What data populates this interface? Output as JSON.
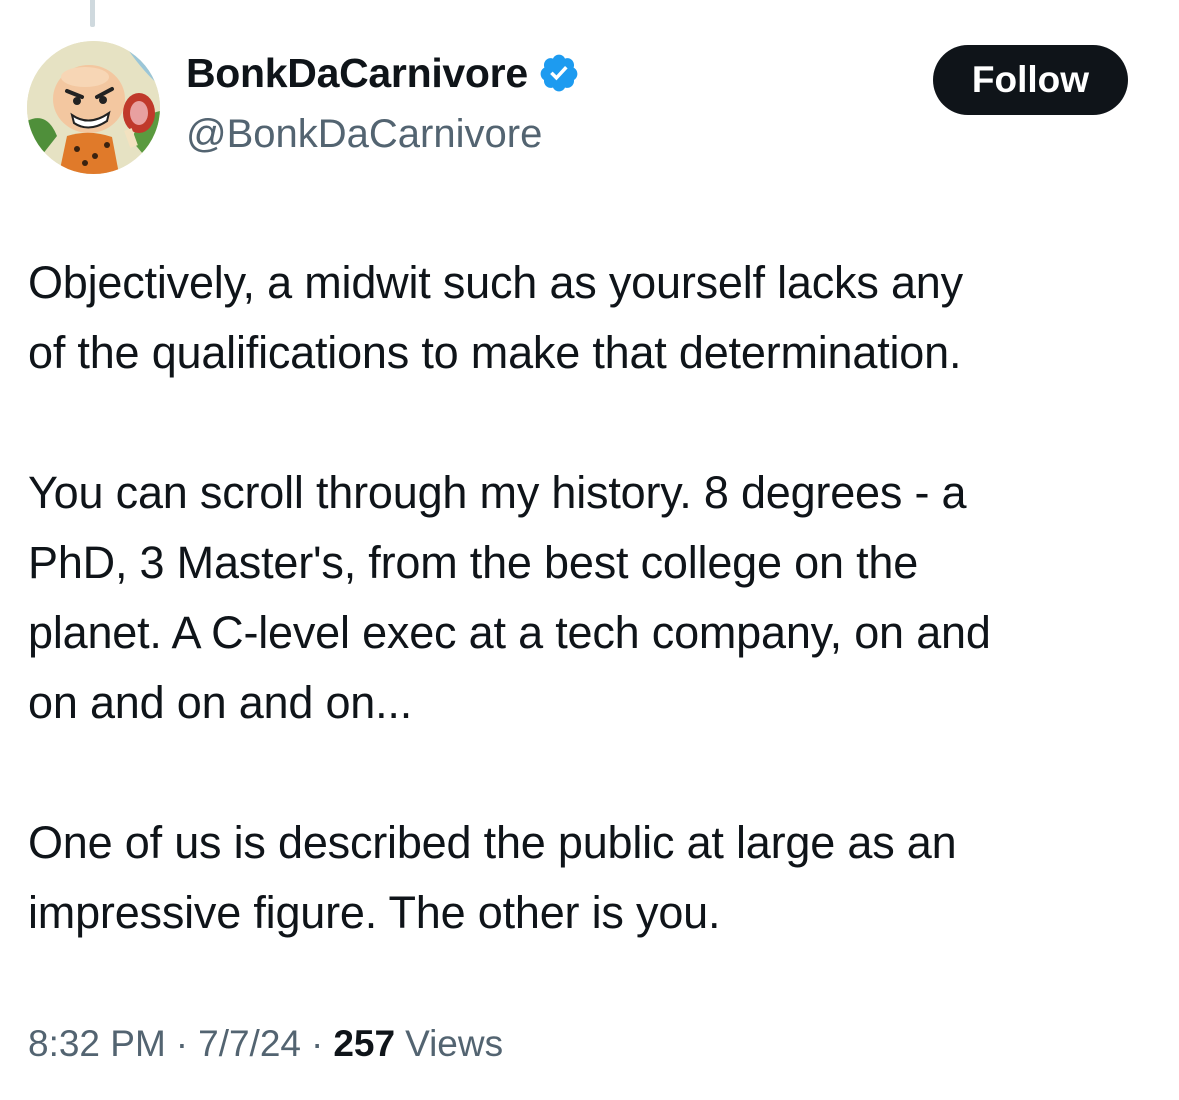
{
  "author": {
    "display_name": "BonkDaCarnivore",
    "handle": "@BonkDaCarnivore",
    "verified": true,
    "verified_icon": "verified-badge-icon",
    "verified_color": "#1d9bf0",
    "avatar_icon": "cartoon-caveman-avatar"
  },
  "follow_button": {
    "label": "Follow",
    "color": "#0f1419"
  },
  "tweet": {
    "paragraphs": [
      "Objectively, a midwit such as yourself lacks any\nof the qualifications to make that determination.",
      "You can scroll through my history.  8 degrees - a\nPhD, 3 Master's, from the best college on the\nplanet.  A C-level exec at a tech company, on and\non and on and on...",
      "One of us is described the public at large as an\nimpressive figure.  The other is you."
    ]
  },
  "meta": {
    "time": "8:32 PM",
    "separator": "·",
    "date": "7/7/24",
    "views_count": "257",
    "views_label": "Views"
  }
}
